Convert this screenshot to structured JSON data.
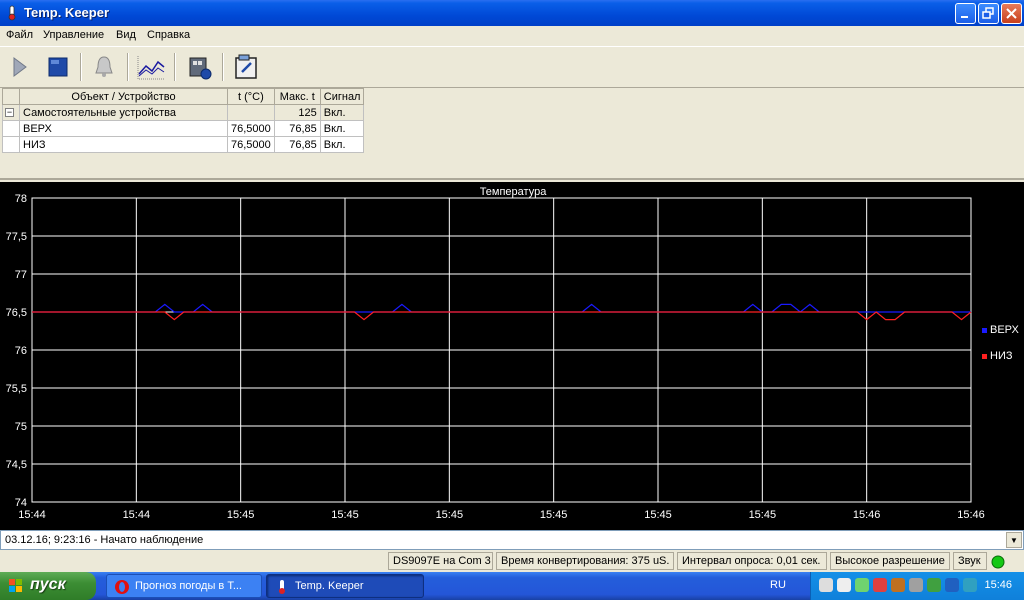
{
  "window": {
    "title": "Temp. Keeper"
  },
  "menu": [
    "Файл",
    "Управление",
    "Вид",
    "Справка"
  ],
  "toolbar": {
    "icons": [
      "play-icon",
      "stop-icon",
      "bell-icon",
      "chart-icon",
      "device-settings-icon",
      "properties-icon"
    ]
  },
  "table": {
    "headers": [
      "Объект / Устройство",
      "t (°C)",
      "Макс. t",
      "Сигнал"
    ],
    "group": {
      "name": "Самостоятельные устройства",
      "t": "",
      "max": "125",
      "signal": "Вкл."
    },
    "rows": [
      {
        "name": "ВЕРХ",
        "t": "76,5000",
        "max": "76,85",
        "signal": "Вкл."
      },
      {
        "name": "НИЗ",
        "t": "76,5000",
        "max": "76,85",
        "signal": "Вкл."
      }
    ]
  },
  "chart_data": {
    "type": "line",
    "title": "Температура",
    "ylim": [
      74,
      78
    ],
    "yticks": [
      "78",
      "77,5",
      "77",
      "76,5",
      "76",
      "75,5",
      "75",
      "74,5",
      "74"
    ],
    "xtick_labels": [
      "15:44",
      "15:44",
      "15:45",
      "15:45",
      "15:45",
      "15:45",
      "15:45",
      "15:45",
      "15:46",
      "15:46"
    ],
    "grid": true,
    "legend_position": "right",
    "series": [
      {
        "name": "ВЕРХ",
        "color": "#1a1aff",
        "values": [
          76.5,
          76.5,
          76.5,
          76.5,
          76.5,
          76.5,
          76.5,
          76.5,
          76.5,
          76.5,
          76.5,
          76.5,
          76.5,
          76.5,
          76.6,
          76.5,
          76.5,
          76.5,
          76.6,
          76.5,
          76.5,
          76.5,
          76.5,
          76.5,
          76.5,
          76.5,
          76.5,
          76.5,
          76.5,
          76.5,
          76.5,
          76.5,
          76.5,
          76.5,
          76.5,
          76.5,
          76.5,
          76.5,
          76.5,
          76.6,
          76.5,
          76.5,
          76.5,
          76.5,
          76.5,
          76.5,
          76.5,
          76.5,
          76.5,
          76.5,
          76.5,
          76.5,
          76.5,
          76.5,
          76.5,
          76.5,
          76.5,
          76.5,
          76.5,
          76.6,
          76.5,
          76.5,
          76.5,
          76.5,
          76.5,
          76.5,
          76.5,
          76.5,
          76.5,
          76.5,
          76.5,
          76.5,
          76.5,
          76.5,
          76.5,
          76.5,
          76.6,
          76.5,
          76.5,
          76.6,
          76.6,
          76.5,
          76.6,
          76.5,
          76.5,
          76.5,
          76.5,
          76.5,
          76.5,
          76.5,
          76.5,
          76.5,
          76.5,
          76.5,
          76.5,
          76.5,
          76.5,
          76.5,
          76.5,
          76.5
        ]
      },
      {
        "name": "НИЗ",
        "color": "#ff2020",
        "values": [
          76.5,
          76.5,
          76.5,
          76.5,
          76.5,
          76.5,
          76.5,
          76.5,
          76.5,
          76.5,
          76.5,
          76.5,
          76.5,
          76.5,
          76.5,
          76.4,
          76.5,
          76.5,
          76.5,
          76.5,
          76.5,
          76.5,
          76.5,
          76.5,
          76.5,
          76.5,
          76.5,
          76.5,
          76.5,
          76.5,
          76.5,
          76.5,
          76.5,
          76.5,
          76.5,
          76.4,
          76.5,
          76.5,
          76.5,
          76.5,
          76.5,
          76.5,
          76.5,
          76.5,
          76.5,
          76.5,
          76.5,
          76.5,
          76.5,
          76.5,
          76.5,
          76.5,
          76.5,
          76.5,
          76.5,
          76.5,
          76.5,
          76.5,
          76.5,
          76.5,
          76.5,
          76.5,
          76.5,
          76.5,
          76.5,
          76.5,
          76.5,
          76.5,
          76.5,
          76.5,
          76.5,
          76.5,
          76.5,
          76.5,
          76.5,
          76.5,
          76.5,
          76.5,
          76.5,
          76.5,
          76.5,
          76.5,
          76.5,
          76.5,
          76.5,
          76.5,
          76.5,
          76.5,
          76.4,
          76.5,
          76.4,
          76.4,
          76.5,
          76.5,
          76.5,
          76.5,
          76.5,
          76.5,
          76.4,
          76.5
        ]
      }
    ]
  },
  "log": {
    "text": "03.12.16; 9:23:16 - Начато наблюдение"
  },
  "status": {
    "device": "DS9097E на Com 3",
    "conversion": "Время конвертирования: 375 uS.",
    "interval": "Интервал опроса: 0,01 сек.",
    "resolution": "Высокое разрешение",
    "sound": "Звук"
  },
  "taskbar": {
    "start": "пуск",
    "tasks": [
      "Прогноз погоды в Т...",
      "Temp. Keeper"
    ],
    "lang": "RU",
    "clock": "15:46"
  }
}
